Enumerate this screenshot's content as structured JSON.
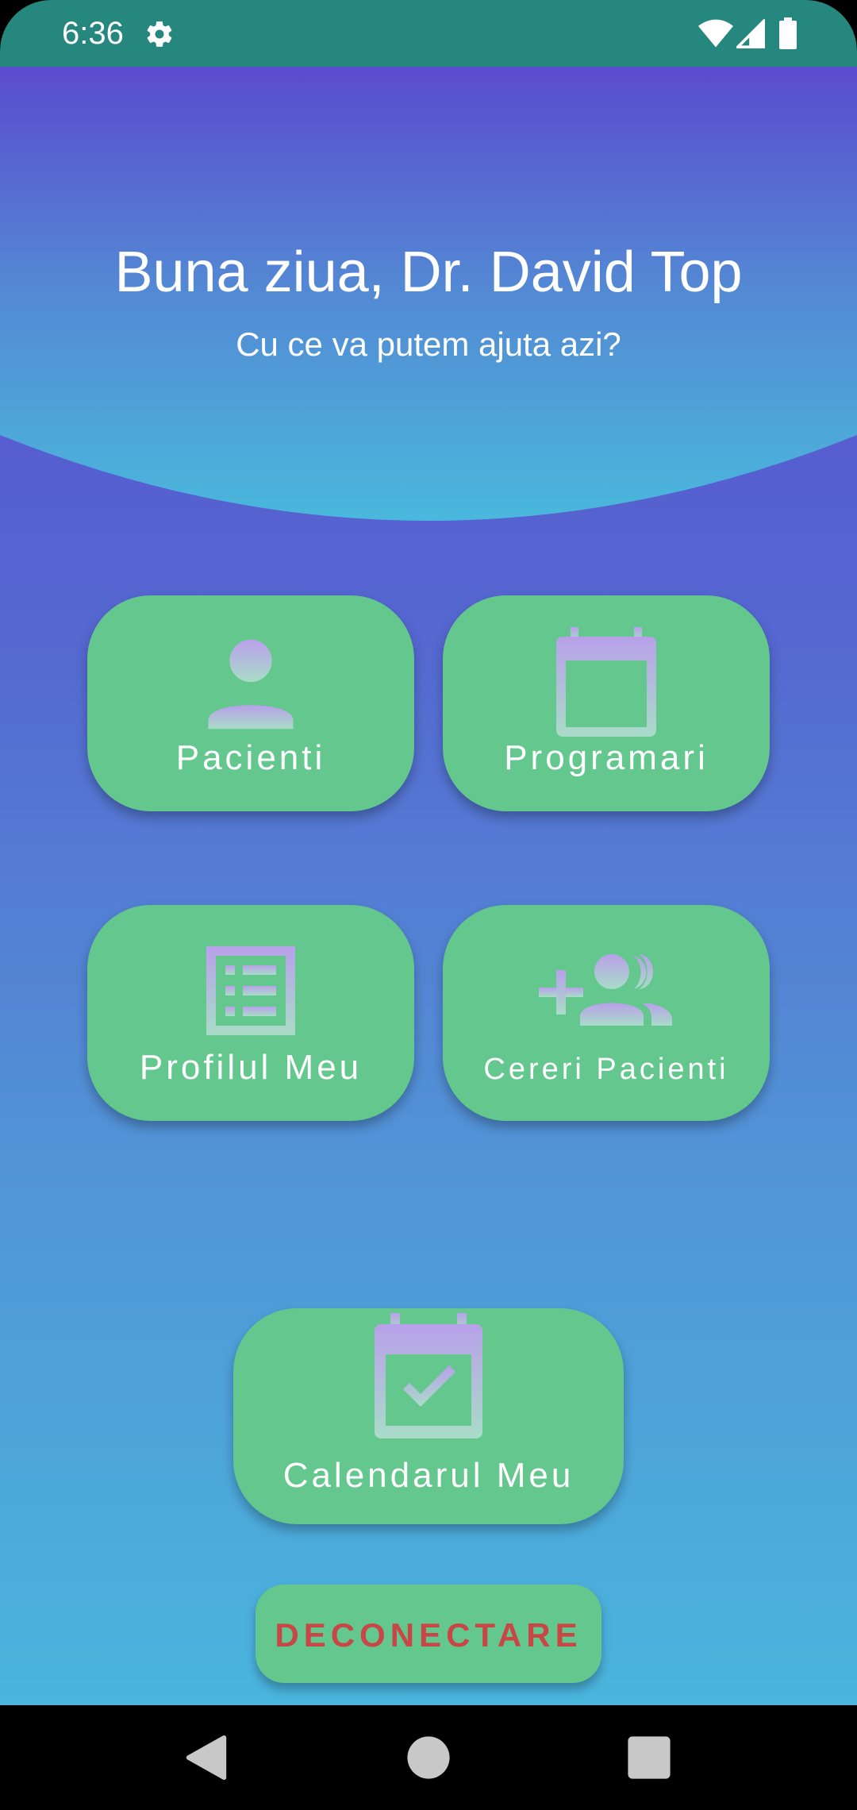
{
  "status_bar": {
    "time": "6:36",
    "icons": [
      "gear-icon",
      "wifi-icon",
      "signal-icon",
      "battery-icon"
    ]
  },
  "header": {
    "greeting": "Buna ziua, Dr. David Top",
    "subtitle": "Cu ce va putem ajuta azi?"
  },
  "tiles": [
    {
      "label": "Pacienti",
      "icon": "person-icon"
    },
    {
      "label": "Programari",
      "icon": "calendar-icon"
    },
    {
      "label": "Profilul Meu",
      "icon": "list-icon"
    },
    {
      "label": "Cereri Pacienti",
      "icon": "group-add-icon"
    },
    {
      "label": "Calendarul Meu",
      "icon": "calendar-check-icon"
    }
  ],
  "logout": {
    "label": "DECONECTARE"
  },
  "nav": {
    "icons": [
      "back-icon",
      "home-icon",
      "recents-icon"
    ]
  },
  "colors": {
    "status_bar": "#26877f",
    "tile": "#63c78e",
    "logout_text": "#c94646",
    "gradient_top": "#5a4bcf",
    "gradient_bottom": "#4ab5dd"
  }
}
